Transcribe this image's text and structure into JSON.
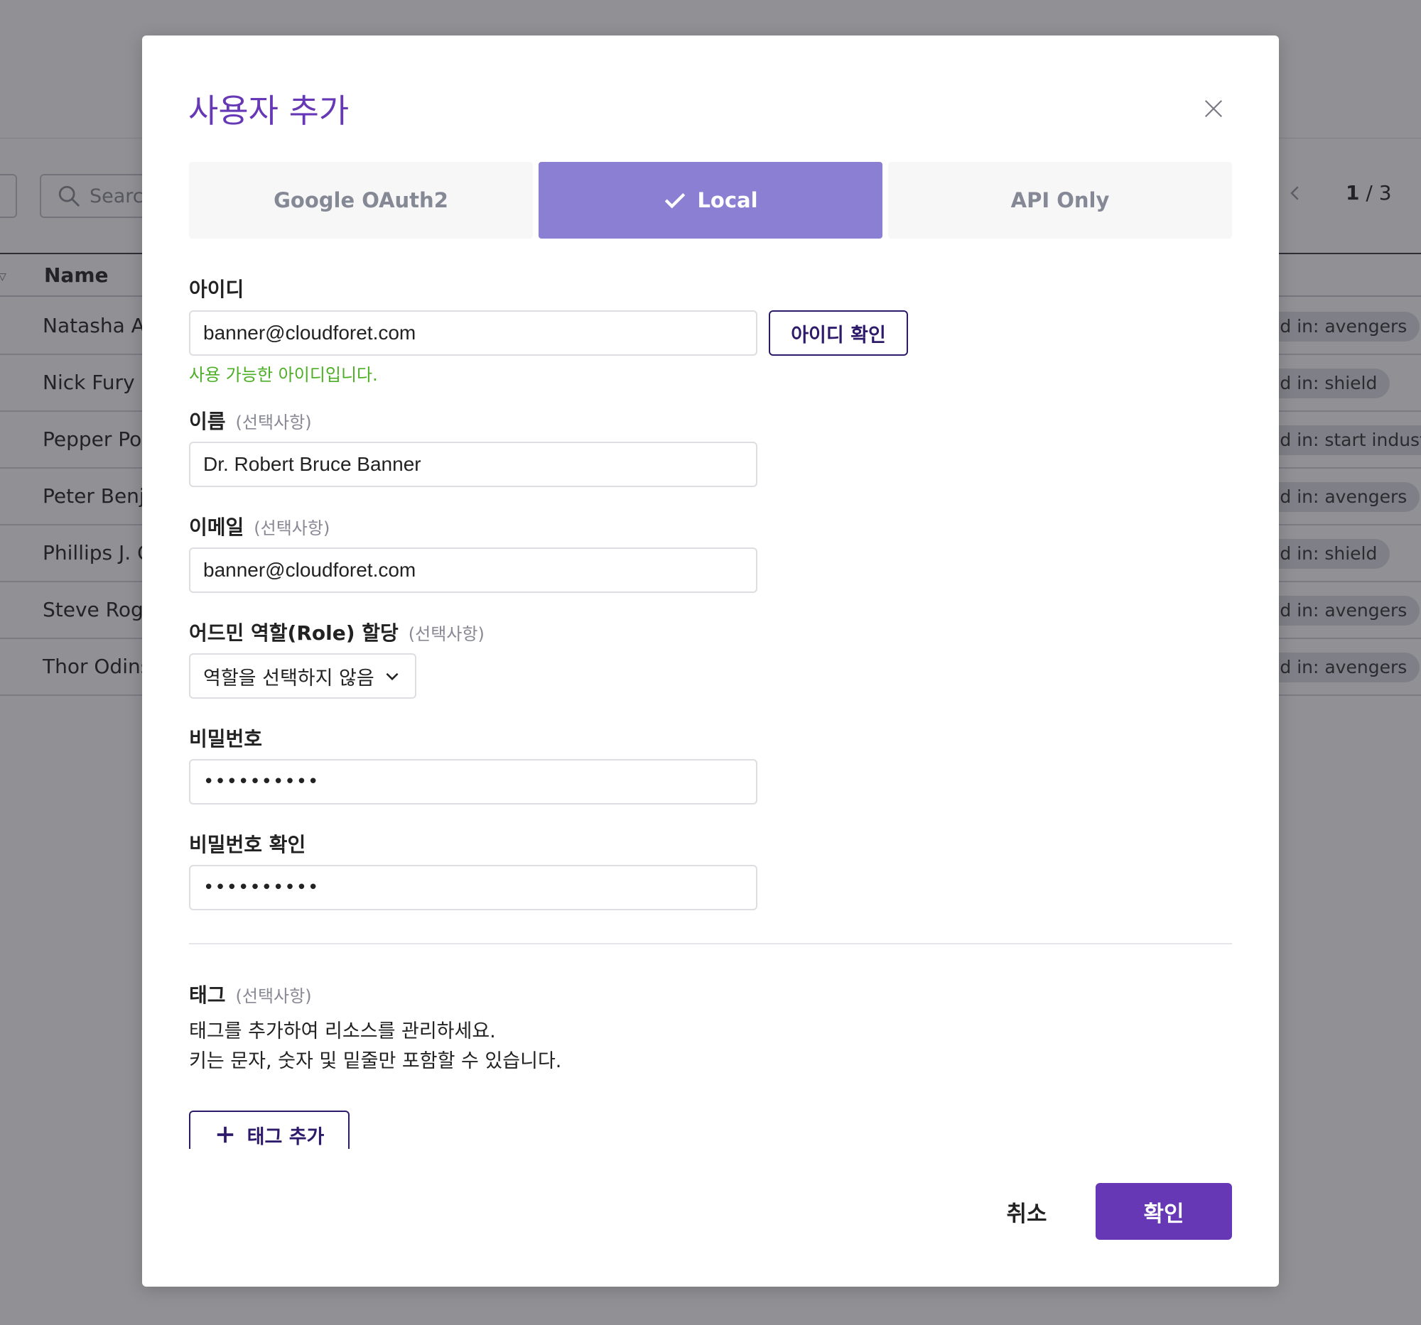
{
  "background": {
    "search": {
      "placeholder": "Search"
    },
    "pagination": {
      "current": "1",
      "separator": " / ",
      "total": "3"
    },
    "table": {
      "name_header": "Name",
      "rows": [
        {
          "name": "Natasha Al",
          "tag": "ed in: avengers"
        },
        {
          "name": "Nick Fury",
          "tag": "ed in: shield"
        },
        {
          "name": "Pepper Pot",
          "tag": "ed in: start indust"
        },
        {
          "name": "Peter Benj",
          "tag": "ed in: avengers"
        },
        {
          "name": "Phillips J. C",
          "tag": "ed in: shield"
        },
        {
          "name": "Steve Roge",
          "tag": "ed in: avengers"
        },
        {
          "name": "Thor Odins",
          "tag": "ed in: avengers"
        }
      ]
    }
  },
  "modal": {
    "title": "사용자 추가",
    "auth_tabs": [
      {
        "label": "Google OAuth2",
        "active": false
      },
      {
        "label": "Local",
        "active": true
      },
      {
        "label": "API Only",
        "active": false
      }
    ],
    "id_field": {
      "label": "아이디",
      "value": "banner@cloudforet.com",
      "check_button": "아이디 확인",
      "help_text": "사용 가능한 아이디입니다."
    },
    "name_field": {
      "label": "이름",
      "optional": "(선택사항)",
      "value": "Dr. Robert Bruce Banner"
    },
    "email_field": {
      "label": "이메일",
      "optional": "(선택사항)",
      "value": "banner@cloudforet.com"
    },
    "role_field": {
      "label": "어드민 역할(Role) 할당",
      "optional": "(선택사항)",
      "selected": "역할을 선택하지 않음"
    },
    "password_field": {
      "label": "비밀번호",
      "value": "••••••••••"
    },
    "password_confirm_field": {
      "label": "비밀번호 확인",
      "value": "••••••••••"
    },
    "tags": {
      "label": "태그",
      "optional": "(선택사항)",
      "desc_line1": "태그를 추가하여 리소스를 관리하세요.",
      "desc_line2": "키는 문자, 숫자 및 밑줄만 포함할 수 있습니다.",
      "add_button": "태그 추가"
    },
    "footer": {
      "cancel": "취소",
      "confirm": "확인"
    }
  },
  "colors": {
    "accent": "#6638b6",
    "active_tab": "#8b7fd4",
    "success": "#4caf25",
    "outline_button": "#2e1a6b"
  }
}
